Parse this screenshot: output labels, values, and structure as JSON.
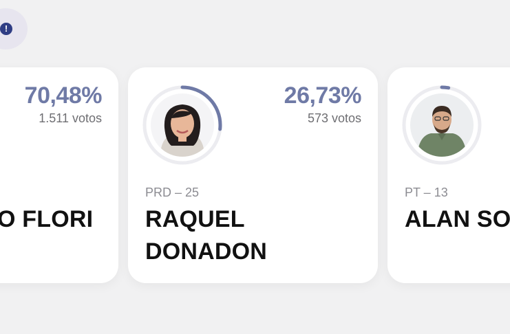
{
  "colors": {
    "accent": "#6f7aa6",
    "info_badge_bg": "#e7e5ef",
    "info_dot": "#2f3d84",
    "card_bg": "#ffffff",
    "page_bg": "#f1f1f2"
  },
  "info_badge": {
    "icon": "exclamation-icon",
    "glyph": "!"
  },
  "candidates": [
    {
      "percentage": "70,48%",
      "votes": "1.511 votos",
      "party": "",
      "name_line1": "O FLORI",
      "name_line2": "",
      "vote_share": 70.48
    },
    {
      "percentage": "26,73%",
      "votes": "573 votos",
      "party": "PRD – 25",
      "name_line1": "RAQUEL",
      "name_line2": "DONADON",
      "vote_share": 26.73
    },
    {
      "percentage": "",
      "votes": "",
      "party": "PT – 13",
      "name_line1": "ALAN SOU",
      "name_line2": "",
      "vote_share": 2.8
    }
  ]
}
